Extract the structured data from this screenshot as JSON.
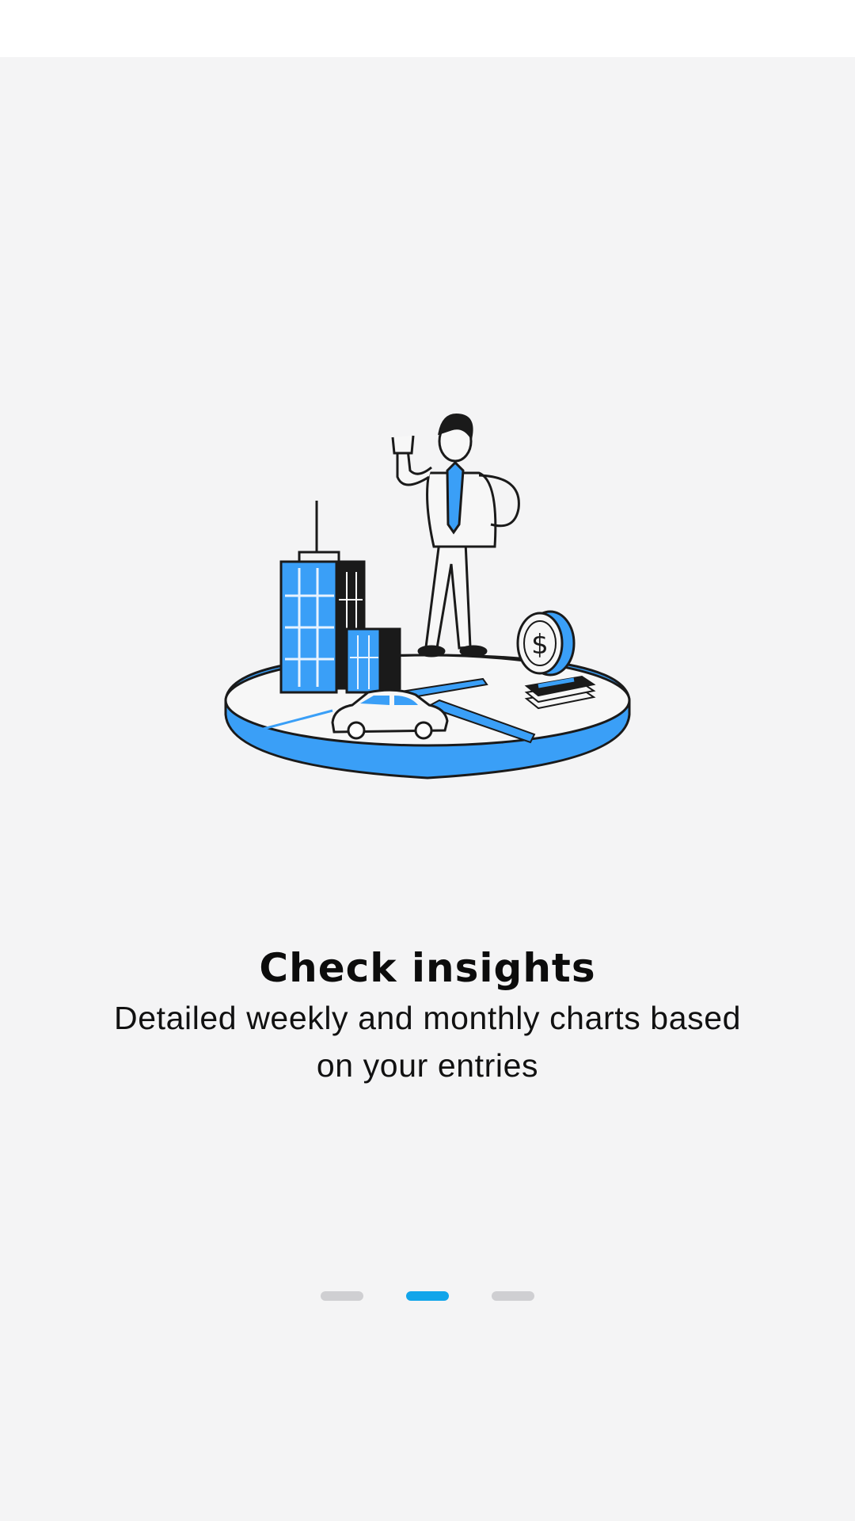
{
  "onboarding": {
    "title": "Check insights",
    "subtitle": "Detailed weekly and monthly charts based on your entries",
    "illustration": "businessman-city-coin-illustration",
    "pager": {
      "total": 3,
      "active_index": 1
    }
  },
  "colors": {
    "accent": "#12a5ea",
    "illustration_blue": "#3a9ff7",
    "inactive_dot": "#cfcfd2",
    "background": "#f4f4f5"
  }
}
